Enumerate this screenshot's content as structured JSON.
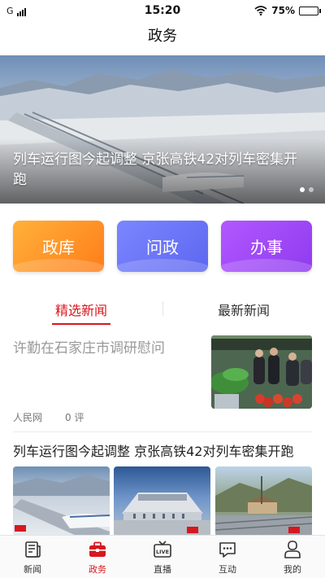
{
  "status_bar": {
    "network": "G",
    "time": "15:20",
    "battery": "75%",
    "battery_level": 0.75
  },
  "page_title": "政务",
  "banner": {
    "caption": "列车运行图今起调整 京张高铁42对列车密集开跑",
    "slide_count": 2,
    "active_slide": 0
  },
  "categories": [
    {
      "label": "政库",
      "color": "#ff8a22"
    },
    {
      "label": "问政",
      "color": "#6a73f6"
    },
    {
      "label": "办事",
      "color": "#9e47f5"
    }
  ],
  "tabs": [
    {
      "label": "精选新闻",
      "active": true
    },
    {
      "label": "最新新闻",
      "active": false
    }
  ],
  "news": [
    {
      "title": "许勤在石家庄市调研慰问",
      "source": "人民网",
      "comments": "0 评"
    },
    {
      "title": "列车运行图今起调整 京张高铁42对列车密集开跑",
      "image_count": 3
    }
  ],
  "bottom_nav": [
    {
      "label": "新闻",
      "icon": "newspaper-icon",
      "active": false
    },
    {
      "label": "政务",
      "icon": "briefcase-icon",
      "active": true
    },
    {
      "label": "直播",
      "icon": "live-tv-icon",
      "active": false
    },
    {
      "label": "互动",
      "icon": "chat-bubble-icon",
      "active": false
    },
    {
      "label": "我的",
      "icon": "user-icon",
      "active": false
    }
  ],
  "bottom_nav_live_text": "LIVE",
  "accent_color": "#d7171f"
}
